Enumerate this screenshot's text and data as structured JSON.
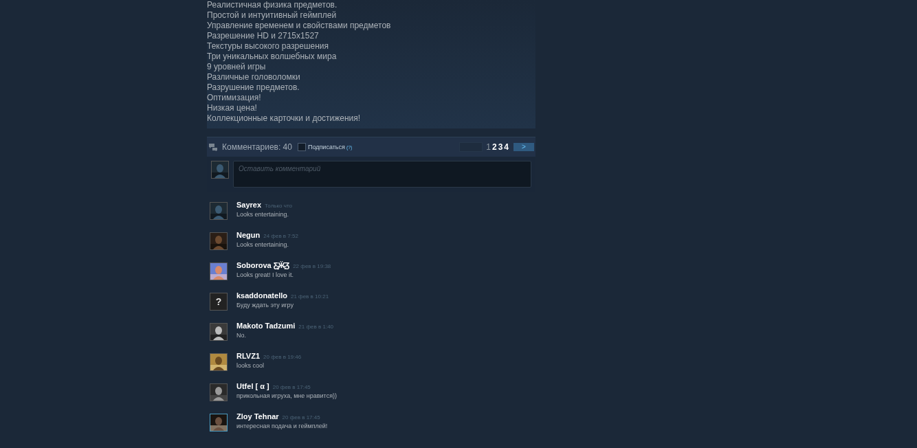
{
  "description": {
    "lines": [
      "Реалистичная физика предметов.",
      "Простой и интуитивный геймплей",
      "Управление временем и свойствами предметов",
      "Разрешение HD и 2715x1527",
      "Текстуры высокого разрешения",
      "Три уникальных волшебных мира",
      "9 уровней игры",
      "Различные головоломки",
      "Разрушение предметов.",
      "Оптимизация!",
      "Низкая цена!",
      "Коллекционные карточки и достижения!"
    ]
  },
  "comments_header": {
    "count_label": "Комментариев: 40",
    "subscribe": {
      "label": "Подписаться",
      "help": "(?)",
      "checked": false
    },
    "pagination": {
      "prev_disabled": true,
      "pages": [
        {
          "label": "1",
          "selected": true
        },
        {
          "label": "2",
          "selected": false
        },
        {
          "label": "3",
          "selected": false
        },
        {
          "label": "4",
          "selected": false
        }
      ],
      "next": ">"
    }
  },
  "composer": {
    "placeholder": "Оставить комментарий"
  },
  "comments": [
    {
      "author": "Sayrex",
      "time": "Только что",
      "text": "Looks entertaining.",
      "avatar": {
        "kind": "picture",
        "online": false
      }
    },
    {
      "author": "Negun",
      "time": "24 фев в 7:52",
      "text": "Looks entertaining.",
      "avatar": {
        "kind": "picture",
        "online": false
      }
    },
    {
      "author": "Soborova Ƹ̵̡Ӝ̵̨̄Ʒ",
      "time": "22 фев в 19:38",
      "text": "Looks great! I love it.",
      "avatar": {
        "kind": "picture",
        "online": false
      }
    },
    {
      "author": "ksaddonatello",
      "time": "21 фев в 10:21",
      "text": "Буду ждать эту игру",
      "avatar": {
        "kind": "unknown",
        "glyph": "?",
        "online": false
      }
    },
    {
      "author": "Makoto Tadzumi",
      "time": "21 фев в 1:40",
      "text": "No.",
      "avatar": {
        "kind": "picture",
        "online": false
      }
    },
    {
      "author": "RLVZ1",
      "time": "20 фев в 19:46",
      "text": "looks cool",
      "avatar": {
        "kind": "picture",
        "online": false
      }
    },
    {
      "author": "Utfel [ α ]",
      "time": "20 фев в 17:45",
      "text": "прикольная игруха, мне нравится))",
      "avatar": {
        "kind": "picture",
        "online": false
      }
    },
    {
      "author": "Zloy Tehnar",
      "time": "20 фев в 17:45",
      "text": "интересная подача и геймплей!",
      "avatar": {
        "kind": "picture",
        "online": true
      }
    }
  ]
}
